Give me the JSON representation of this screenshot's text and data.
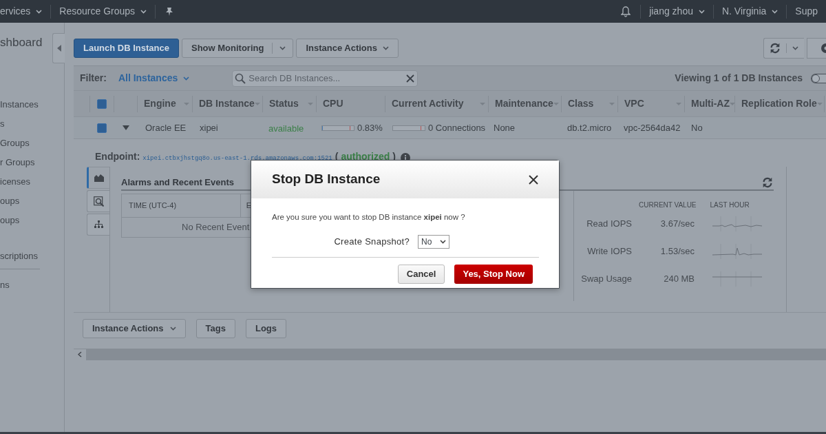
{
  "top_nav": {
    "left_items": [
      {
        "label": "ervices",
        "dropdown": true
      },
      {
        "label": "Resource Groups",
        "dropdown": true
      }
    ],
    "right_items": [
      {
        "label": "jiang zhou",
        "dropdown": true
      },
      {
        "label": "N. Virginia",
        "dropdown": true
      },
      {
        "label": "Supp",
        "dropdown": false
      }
    ]
  },
  "sidebar": {
    "title": "shboard",
    "sections": [
      {
        "divider": false,
        "items": [
          "Instances",
          "s",
          "Groups",
          "r Groups",
          "icenses",
          "oups",
          "oups"
        ]
      },
      {
        "divider": true,
        "items": [
          "scriptions"
        ]
      },
      {
        "divider": false,
        "items": [
          "ns"
        ]
      }
    ]
  },
  "toolbar": {
    "buttons": [
      {
        "label": "Launch DB Instance",
        "kind": "primary"
      },
      {
        "label": "Show Monitoring",
        "kind": "split"
      },
      {
        "label": "Instance Actions",
        "kind": "dropdown"
      }
    ]
  },
  "filter": {
    "label": "Filter:",
    "value": "All Instances",
    "search_placeholder": "Search DB Instances...",
    "viewing": "Viewing 1 of 1 DB Instances",
    "toggle": {
      "on": false
    }
  },
  "table": {
    "select_all": {
      "checked": true
    },
    "columns": [
      {
        "label": "Engine",
        "sortable": true
      },
      {
        "label": "DB Instance",
        "sortable": true
      },
      {
        "label": "Status",
        "sortable": true
      },
      {
        "label": "CPU",
        "sortable": false
      },
      {
        "label": "Current Activity",
        "sortable": true
      },
      {
        "label": "Maintenance",
        "sortable": true
      },
      {
        "label": "Class",
        "sortable": true
      },
      {
        "label": "VPC",
        "sortable": true
      },
      {
        "label": "Multi-AZ",
        "sortable": true
      },
      {
        "label": "Replication Role",
        "sortable": true
      }
    ],
    "rows": [
      {
        "checked": true,
        "expanded": true,
        "engine": "Oracle EE",
        "db_instance": "xipei",
        "status": "available",
        "cpu": {
          "level": 0.0083,
          "reading": "0.83%"
        },
        "activity": {
          "level": 0,
          "reading": "0 Connections"
        },
        "maintenance": "None",
        "class": "db.t2.micro",
        "vpc": "vpc-2564da42",
        "multi_az": "No"
      }
    ]
  },
  "details": {
    "endpoint": {
      "label": "Endpoint:",
      "value": "xipei.ctbxjhstgq8o.us-east-1.rds.amazonaws.com:1521",
      "open": "(",
      "status": "authorized",
      "close": ")"
    },
    "tabs": [
      {
        "kind": "chart",
        "selected": true
      },
      {
        "kind": "search",
        "selected": false
      },
      {
        "kind": "tree",
        "selected": false
      }
    ],
    "events": {
      "title": "Alarms and Recent Events",
      "columns": [
        "TIME (UTC-4)",
        "E"
      ],
      "empty": "No Recent Event"
    },
    "metrics": {
      "columns": [
        "CURRENT VALUE",
        "LAST HOUR"
      ],
      "rows": [
        {
          "label": "Read IOPS",
          "value": "3.67/sec",
          "kind": "small"
        },
        {
          "label": "Write IOPS",
          "value": "1.53/sec",
          "kind": "peak"
        },
        {
          "label": "Swap Usage",
          "value": "240 MB",
          "kind": "flat"
        }
      ]
    },
    "buttons": [
      {
        "label": "Instance Actions",
        "dropdown": true
      },
      {
        "label": "Tags",
        "dropdown": false
      },
      {
        "label": "Logs",
        "dropdown": false
      }
    ]
  },
  "modal": {
    "title": "Stop DB Instance",
    "message": "Are you sure you want to stop DB instance **xipei** now ?",
    "field_label": "Create Snapshot?",
    "field_value": "No",
    "buttons": [
      {
        "label": "Cancel",
        "kind": "secondary"
      },
      {
        "label": "Yes, Stop Now",
        "kind": "danger"
      }
    ]
  }
}
